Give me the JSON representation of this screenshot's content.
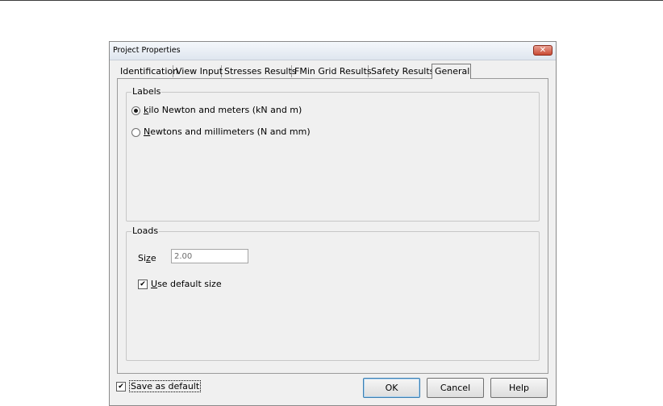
{
  "window": {
    "title": "Project Properties",
    "close_glyph": "✕"
  },
  "tabs": [
    {
      "label": "Identification",
      "active": false
    },
    {
      "label": "View Input",
      "active": false
    },
    {
      "label": "Stresses Results",
      "active": false
    },
    {
      "label": "FMin Grid Results",
      "active": false
    },
    {
      "label": "Safety Results",
      "active": false
    },
    {
      "label": "General",
      "active": true
    }
  ],
  "labels_group": {
    "legend": "Labels",
    "options": [
      {
        "accel": "k",
        "rest": "ilo Newton and meters  (kN and m)",
        "checked": true
      },
      {
        "accel": "N",
        "rest": "ewtons and millimeters (N and mm)",
        "checked": false
      }
    ]
  },
  "loads_group": {
    "legend": "Loads",
    "size_label_pre": "Si",
    "size_label_accel": "z",
    "size_label_post": "e",
    "size_value": "2.00",
    "use_default": {
      "accel": "U",
      "rest": "se default size",
      "checked": true
    }
  },
  "footer": {
    "save_default": {
      "label": "Save as default",
      "checked": true
    },
    "buttons": {
      "ok": "OK",
      "cancel": "Cancel",
      "help": "Help"
    }
  },
  "icons": {
    "close": "close-icon",
    "check": "check-icon",
    "radio": "radio-icon"
  }
}
